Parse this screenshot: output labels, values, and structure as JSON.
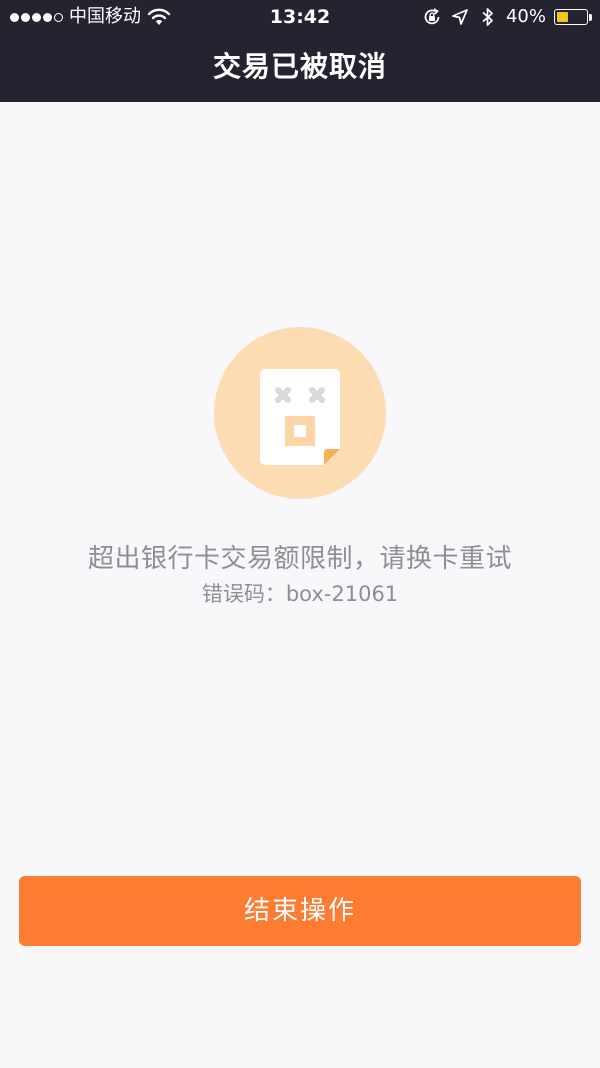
{
  "status_bar": {
    "carrier": "中国移动",
    "time": "13:42",
    "battery_percent": "40%",
    "battery_level": 0.4,
    "signal_bars_filled": 4,
    "signal_bars_total": 5,
    "icons": [
      "wifi-icon",
      "rotation-lock-icon",
      "location-arrow-icon",
      "bluetooth-icon",
      "battery-icon"
    ]
  },
  "nav": {
    "title": "交易已被取消"
  },
  "illustration": {
    "icon": "cancelled-receipt-icon",
    "circle_color": "#fddcb4",
    "accent_color": "#f7b05a"
  },
  "content": {
    "message": "超出银行卡交易额限制，请换卡重试",
    "error_label": "错误码：",
    "error_code": "box-21061"
  },
  "actions": {
    "finish_label": "结束操作",
    "button_color": "#fe7b32"
  },
  "colors": {
    "header_bg": "#23242f",
    "page_bg": "#f8f8fb",
    "text_muted": "#8e8e98",
    "battery_fill": "#f5c51c"
  }
}
